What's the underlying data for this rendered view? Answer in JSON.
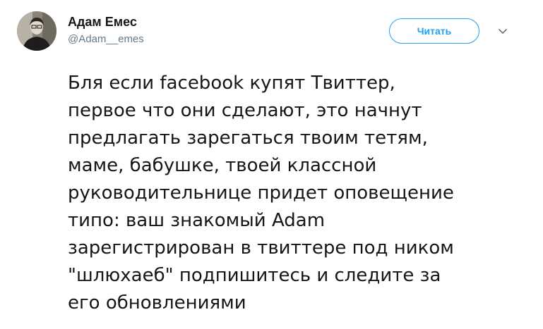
{
  "author": {
    "display_name": "Адам Емес",
    "handle": "@Adam__emes"
  },
  "follow_button": {
    "label": "Читать"
  },
  "icons": {
    "avatar": "avatar-photo",
    "menu": "chevron-down-icon"
  },
  "colors": {
    "accent": "#1da1f2",
    "text": "#14171a",
    "muted": "#657786"
  },
  "tweet": {
    "lines": [
      "Бля если facebook купят Твиттер,",
      "первое что они сделают, это начнут",
      "предлагать зарегаться твоим тетям,",
      "маме, бабушке, твоей классной",
      "руководительнице придет оповещение",
      "типо: ваш знакомый Adam",
      "зарегистрирован в твиттере под ником",
      "\"шлюхаеб\" подпишитесь и следите за",
      "его обновлениями"
    ]
  }
}
